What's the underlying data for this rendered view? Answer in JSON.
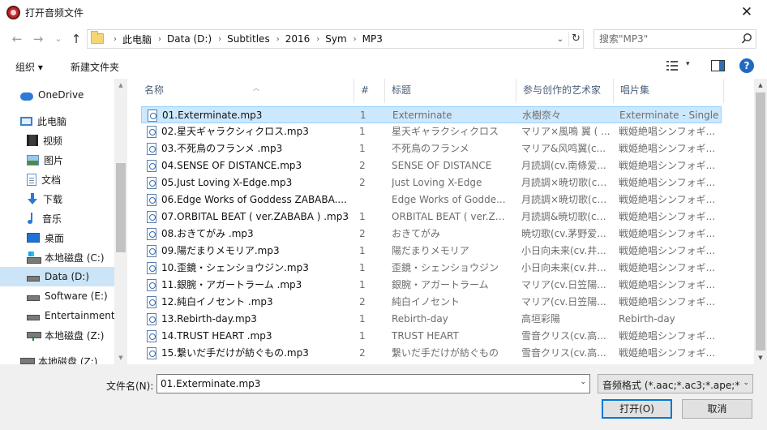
{
  "window": {
    "title": "打开音频文件",
    "close_glyph": "✕"
  },
  "nav": {
    "back_glyph": "←",
    "forward_glyph": "→",
    "recent_glyph": "⌄",
    "up_glyph": "↑"
  },
  "address": {
    "crumbs": [
      "此电脑",
      "Data (D:)",
      "Subtitles",
      "2016",
      "Sym",
      "MP3"
    ],
    "separator": "›",
    "dropdown_glyph": "⌄",
    "refresh_glyph": "↻"
  },
  "search": {
    "placeholder": "搜索\"MP3\""
  },
  "toolbar": {
    "organize_label": "组织 ▾",
    "new_folder_label": "新建文件夹",
    "view_dropdown_glyph": "▾",
    "help_glyph": "?"
  },
  "sidebar": {
    "items": [
      {
        "label": "OneDrive",
        "icon": "cloud-icon"
      },
      {
        "label": "此电脑",
        "icon": "computer-icon"
      },
      {
        "label": "视频",
        "icon": "video-icon"
      },
      {
        "label": "图片",
        "icon": "pictures-icon"
      },
      {
        "label": "文档",
        "icon": "documents-icon"
      },
      {
        "label": "下载",
        "icon": "download-icon"
      },
      {
        "label": "音乐",
        "icon": "music-icon"
      },
      {
        "label": "桌面",
        "icon": "desktop-icon"
      },
      {
        "label": "本地磁盘 (C:)",
        "icon": "windows-drive-icon"
      },
      {
        "label": "Data (D:)",
        "icon": "drive-icon"
      },
      {
        "label": "Software (E:)",
        "icon": "drive-icon"
      },
      {
        "label": "Entertainment (",
        "icon": "drive-icon"
      },
      {
        "label": "本地磁盘 (Z:)",
        "icon": "network-drive-icon"
      },
      {
        "label": "本地磁盘 (Z:)",
        "icon": "network-drive-icon"
      }
    ],
    "selected_index": 9
  },
  "columns": {
    "name": "名称",
    "num": "#",
    "title": "标题",
    "artist": "参与创作的艺术家",
    "album": "唱片集"
  },
  "files": [
    {
      "name": "01.Exterminate.mp3",
      "num": "1",
      "title": "Exterminate",
      "artist": "水樹奈々",
      "album": "Exterminate - Single"
    },
    {
      "name": "02.星天ギャラクシィクロス.mp3",
      "num": "1",
      "title": "星天ギャラクシィクロス",
      "artist": "マリア×風鳴 翼 ( ...",
      "album": "戦姫絶唱シンフォギ..."
    },
    {
      "name": "03.不死鳥のフランメ .mp3",
      "num": "1",
      "title": "不死鳥のフランメ",
      "artist": "マリア&风鸣翼(c...",
      "album": "戦姫絶唱シンフォギ..."
    },
    {
      "name": "04.SENSE OF DISTANCE.mp3",
      "num": "2",
      "title": "SENSE OF DISTANCE",
      "artist": "月読調(cv.南條爱...",
      "album": "戦姫絶唱シンフォギ..."
    },
    {
      "name": "05.Just Loving X-Edge.mp3",
      "num": "2",
      "title": "Just Loving X-Edge",
      "artist": "月読調×暁切歌(cv...",
      "album": "戦姫絶唱シンフォギ..."
    },
    {
      "name": "06.Edge Works of Goddess ZABABA....",
      "num": "",
      "title": "Edge Works of Godde...",
      "artist": "月読調×暁切歌(cv...",
      "album": "戦姫絶唱シンフォギ..."
    },
    {
      "name": "07.ORBITAL BEAT ( ver.ZABABA ) .mp3",
      "num": "1",
      "title": "ORBITAL BEAT ( ver.ZABA...",
      "artist": "月読調&暁切歌(cv...",
      "album": "戦姫絶唱シンフォギ..."
    },
    {
      "name": "08.おきてがみ .mp3",
      "num": "2",
      "title": "おきてがみ",
      "artist": "暁切歌(cv.茅野爱...",
      "album": "戦姫絶唱シンフォギ..."
    },
    {
      "name": "09.陽だまりメモリア.mp3",
      "num": "1",
      "title": "陽だまりメモリア",
      "artist": "小日向未来(cv.井...",
      "album": "戦姫絶唱シンフォギ..."
    },
    {
      "name": "10.歪鏡・シェンショウジン.mp3",
      "num": "1",
      "title": "歪鏡・シェンショウジン",
      "artist": "小日向未来(cv.井...",
      "album": "戦姫絶唱シンフォギ..."
    },
    {
      "name": "11.銀腕・アガートラーム .mp3",
      "num": "1",
      "title": "銀腕・アガートラーム",
      "artist": "マリア(cv.日笠陽...",
      "album": "戦姫絶唱シンフォギ..."
    },
    {
      "name": "12.純白イノセント .mp3",
      "num": "2",
      "title": "純白イノセント",
      "artist": "マリア(cv.日笠陽...",
      "album": "戦姫絶唱シンフォギ..."
    },
    {
      "name": "13.Rebirth-day.mp3",
      "num": "1",
      "title": "Rebirth-day",
      "artist": "高垣彩陽",
      "album": "Rebirth-day"
    },
    {
      "name": "14.TRUST HEART .mp3",
      "num": "1",
      "title": "TRUST HEART",
      "artist": "雪音クリス(cv.高...",
      "album": "戦姫絶唱シンフォギ..."
    },
    {
      "name": "15.繋いだ手だけが紡ぐもの.mp3",
      "num": "2",
      "title": "繋いだ手だけが紡ぐもの",
      "artist": "雪音クリス(cv.高...",
      "album": "戦姫絶唱シンフォギ..."
    }
  ],
  "selected_file_index": 0,
  "footer": {
    "filename_label": "文件名(N):",
    "filename_value": "01.Exterminate.mp3",
    "filetype_label": "音频格式 (*.aac;*.ac3;*.ape;*.c",
    "open_label": "打开(O)",
    "cancel_label": "取消",
    "dropdown_glyph": "⌄"
  },
  "scroll_glyphs": {
    "up": "▲",
    "down": "▼"
  },
  "colors": {
    "selection": "#cce8ff",
    "selection_border": "#99d1ff",
    "nav_selected": "#cce4f7",
    "accent": "#0078d7",
    "header_text": "#4c607a"
  }
}
